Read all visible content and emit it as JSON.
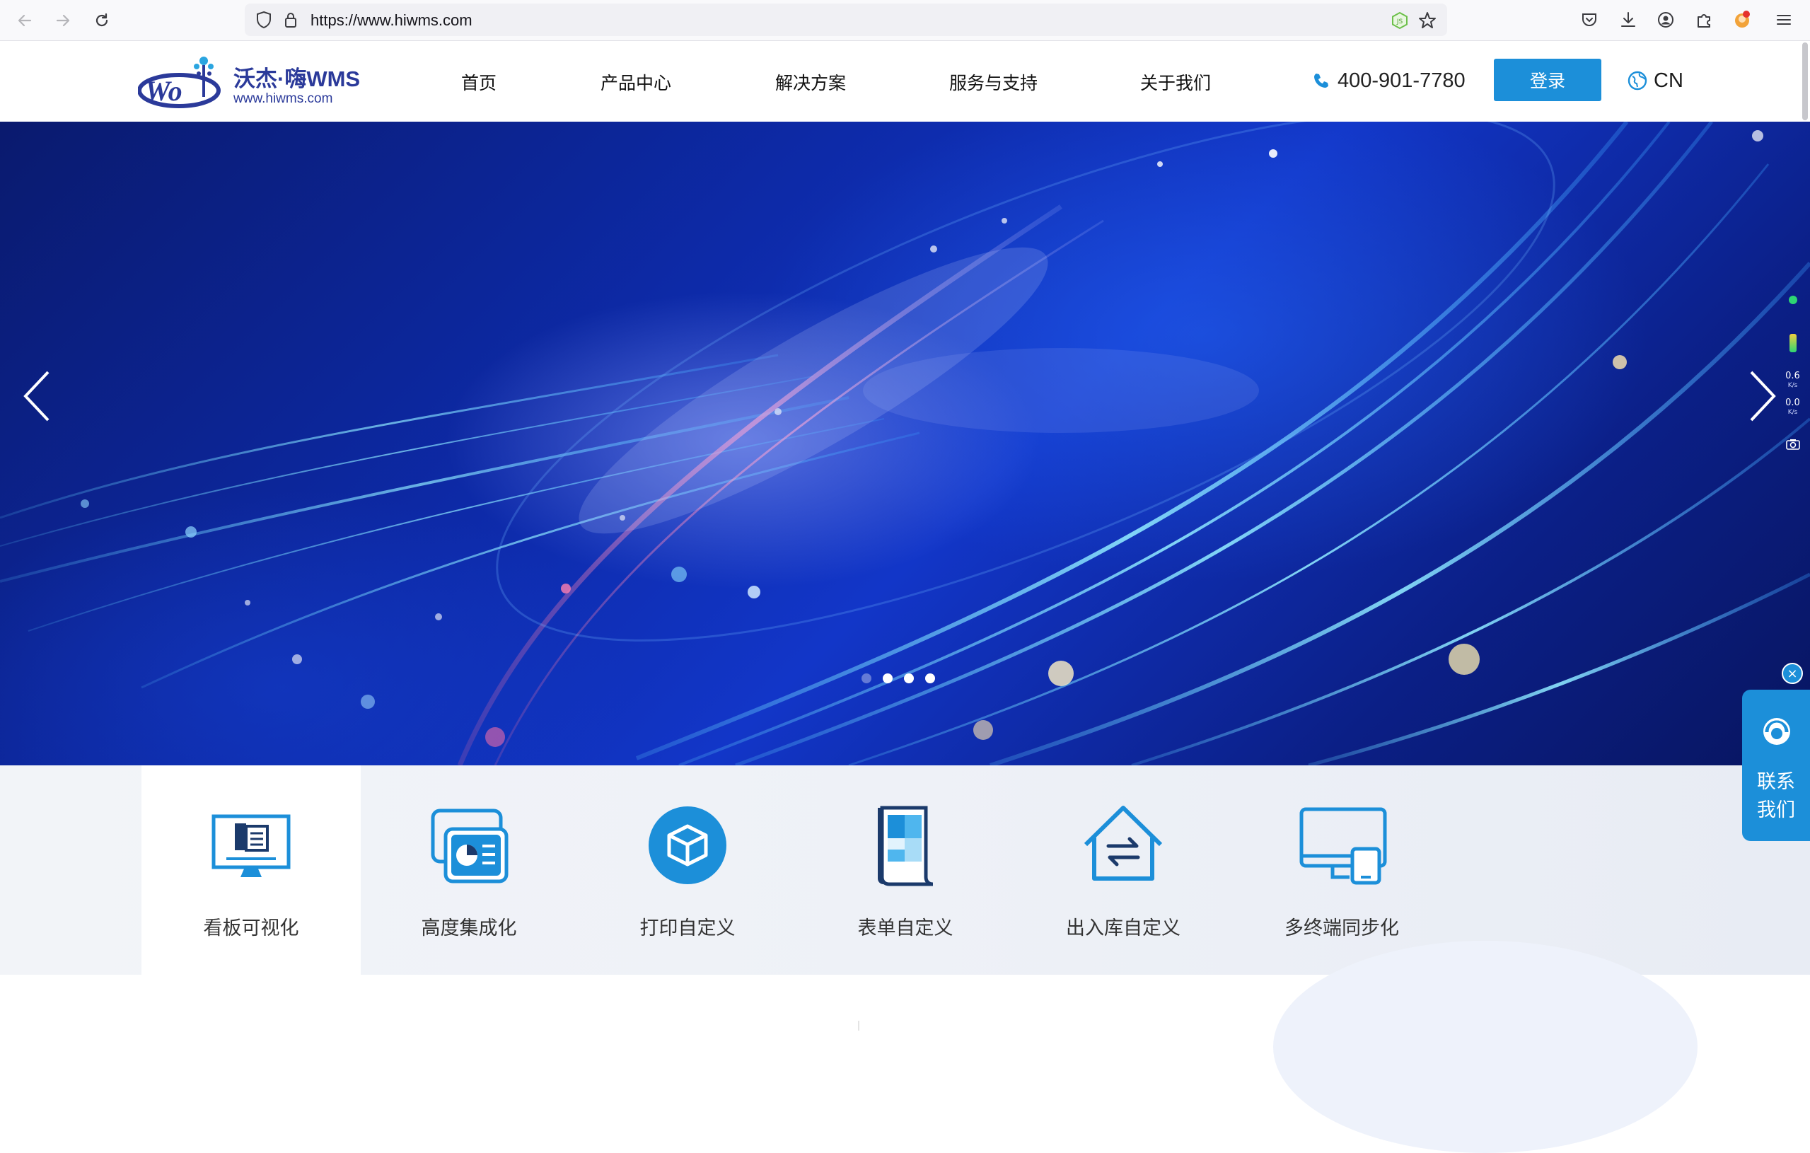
{
  "browser": {
    "url": "https://www.hiwms.com",
    "icons": [
      "back-arrow-icon",
      "forward-arrow-icon",
      "reload-icon",
      "shield-icon",
      "lock-icon",
      "extension-js-icon",
      "star-icon",
      "pocket-icon",
      "download-icon",
      "account-icon",
      "extensions-icon",
      "avatar-extension-icon",
      "menu-icon"
    ]
  },
  "header": {
    "logo_title": "沃杰·嗨WMS",
    "logo_url": "www.hiwms.com",
    "nav": [
      {
        "label": "首页"
      },
      {
        "label": "产品中心"
      },
      {
        "label": "解决方案"
      },
      {
        "label": "服务与支持"
      },
      {
        "label": "关于我们"
      }
    ],
    "phone": "400-901-7780",
    "login_label": "登录",
    "lang_label": "CN",
    "brand_color": "#1c8fd9"
  },
  "banner": {
    "slide_count": 4,
    "active_slide": 1,
    "monitor": {
      "up": "0.6",
      "up_unit": "K/s",
      "down": "0.0",
      "down_unit": "K/s"
    }
  },
  "features": [
    {
      "label": "看板可视化",
      "icon": "dashboard-monitor-icon",
      "active": true
    },
    {
      "label": "高度集成化",
      "icon": "integration-cards-icon",
      "active": false
    },
    {
      "label": "打印自定义",
      "icon": "print-box-icon",
      "active": false
    },
    {
      "label": "表单自定义",
      "icon": "form-document-icon",
      "active": false
    },
    {
      "label": "出入库自定义",
      "icon": "warehouse-inout-icon",
      "active": false
    },
    {
      "label": "多终端同步化",
      "icon": "multi-device-icon",
      "active": false
    }
  ],
  "contact": {
    "line1": "联系",
    "line2": "我们"
  }
}
